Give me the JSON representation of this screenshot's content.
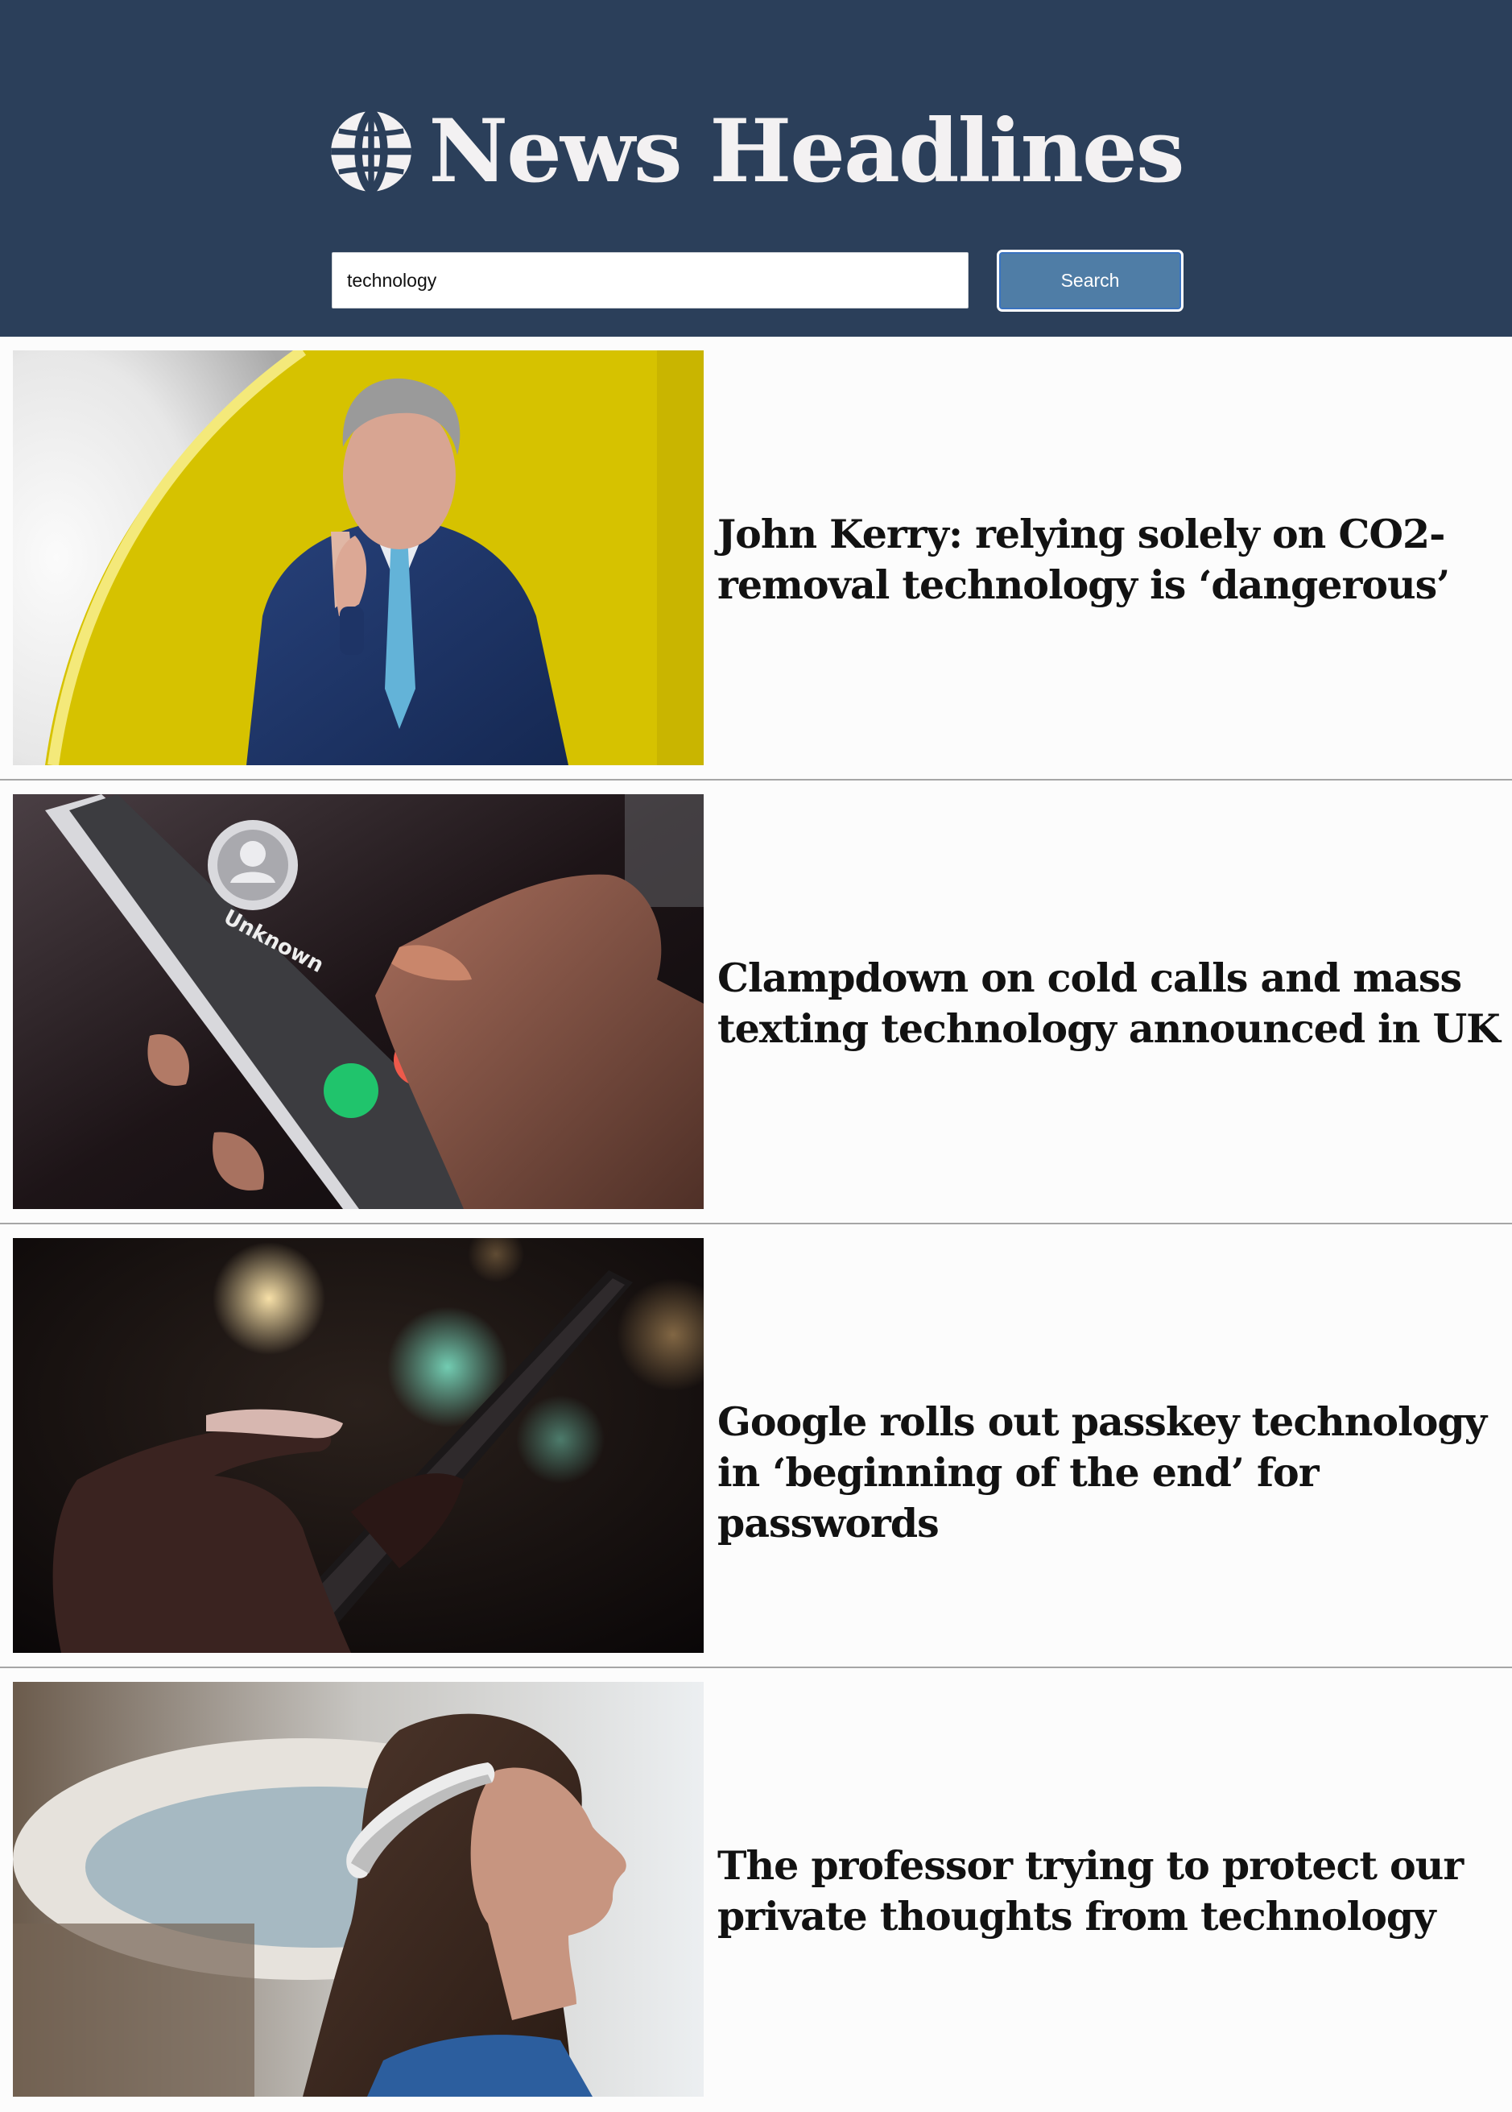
{
  "header": {
    "title": "News Headlines",
    "logo_icon": "globe-icon",
    "background_color": "#2b3f5a"
  },
  "search": {
    "value": "technology",
    "button_label": "Search",
    "button_color": "#4f7da6"
  },
  "articles": [
    {
      "headline": "John Kerry: relying solely on CO2-removal technology is ‘dangerous’",
      "image": "photo-man-in-suit-yellow-backdrop"
    },
    {
      "headline": "Clampdown on cold calls and mass texting technology announced in UK",
      "image": "photo-incoming-call-phone",
      "image_text": "Unknown"
    },
    {
      "headline": "Google rolls out passkey technology in ‘beginning of the end’ for passwords",
      "image": "photo-hand-using-smartphone-at-night"
    },
    {
      "headline": "The professor trying to protect our private thoughts from technology",
      "image": "photo-woman-wearing-headband-device"
    }
  ]
}
